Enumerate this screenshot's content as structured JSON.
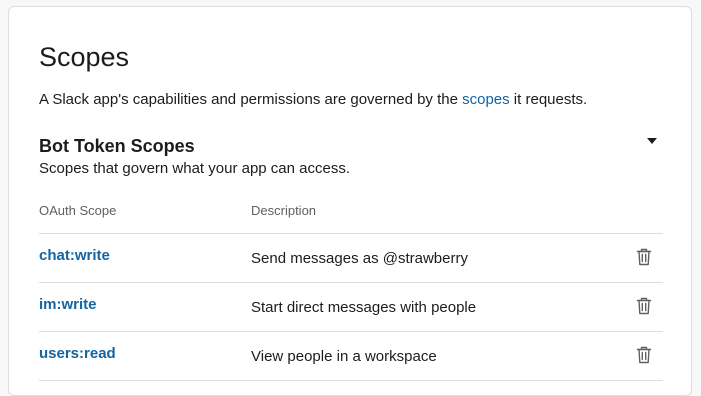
{
  "page": {
    "title": "Scopes",
    "intro_before": "A Slack app's capabilities and permissions are governed by the ",
    "intro_link": "scopes",
    "intro_after": " it requests."
  },
  "bot_token_scopes": {
    "title": "Bot Token Scopes",
    "subtitle": "Scopes that govern what your app can access.",
    "toggle_icon": "caret-down-icon",
    "columns": {
      "scope": "OAuth Scope",
      "description": "Description"
    },
    "rows": [
      {
        "scope": "chat:write",
        "description": "Send messages as @strawberry",
        "action_icon": "trash-icon"
      },
      {
        "scope": "im:write",
        "description": "Start direct messages with people",
        "action_icon": "trash-icon"
      },
      {
        "scope": "users:read",
        "description": "View people in a workspace",
        "action_icon": "trash-icon"
      }
    ]
  },
  "colors": {
    "link": "#1264a3",
    "text": "#1d1c1d",
    "muted": "#616061",
    "border": "#dddddd"
  }
}
